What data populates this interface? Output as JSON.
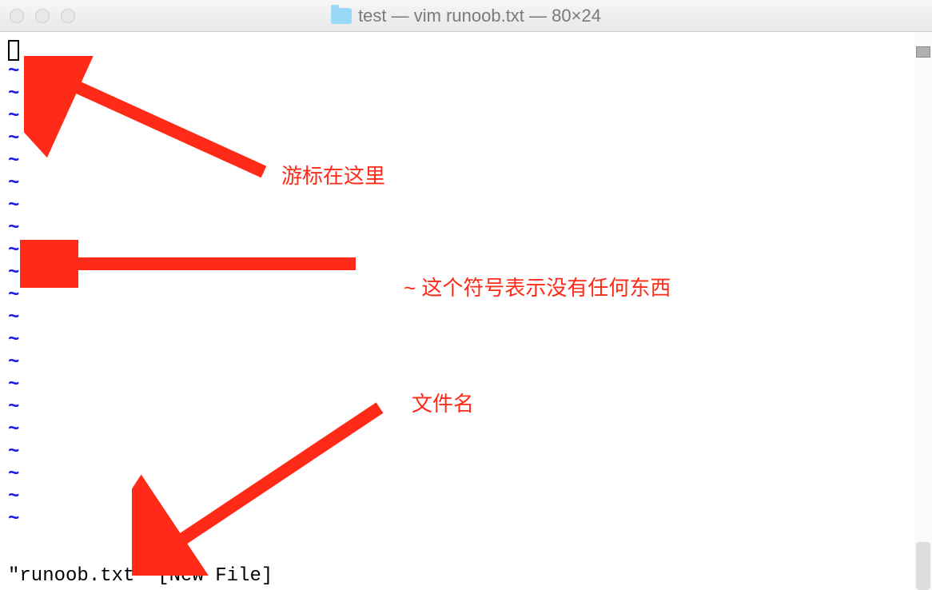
{
  "window": {
    "title": "test — vim runoob.txt — 80×24"
  },
  "editor": {
    "tilde": "~",
    "status_line": "\"runoob.txt\" [New File]"
  },
  "annotations": {
    "cursor_label": "游标在这里",
    "tilde_label": "~ 这个符号表示没有任何东西",
    "filename_label": "文件名"
  }
}
